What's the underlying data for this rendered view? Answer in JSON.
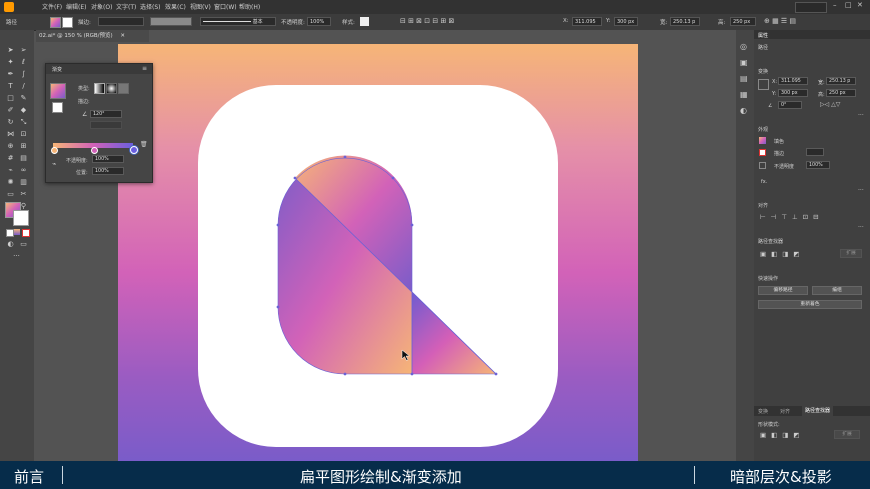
{
  "menubar": {
    "items": [
      "文件(F)",
      "编辑(E)",
      "对象(O)",
      "文字(T)",
      "选择(S)",
      "效果(C)",
      "视图(V)",
      "窗口(W)",
      "帮助(H)"
    ]
  },
  "controlbar": {
    "path_label": "路径",
    "stroke_label": "描边:",
    "stroke_style": "基本",
    "opacity_label": "不透明度:",
    "opacity_value": "100%",
    "style_label": "样式:",
    "x_label": "X:",
    "x_value": "311.095",
    "y_label": "Y:",
    "y_value": "300 px",
    "w_label": "宽:",
    "w_value": "250.13 p",
    "h_label": "高:",
    "h_value": "250 px"
  },
  "document": {
    "tab_title": "02.ai* @ 150 % (RGB/预览)"
  },
  "gradient_panel": {
    "title": "渐变",
    "type_label": "类型:",
    "stroke_label": "描边:",
    "angle_value": "120°",
    "opacity_label": "不透明度:",
    "opacity_value": "100%",
    "location_label": "位置:",
    "location_value": "100%"
  },
  "properties_panel": {
    "tab_title": "属性",
    "section_path": "路径",
    "section_transform": "变换",
    "x_label": "X:",
    "x_value": "311.095",
    "y_label": "Y:",
    "y_value": "300 px",
    "w_label": "宽:",
    "w_value": "250.13 p",
    "h_label": "高:",
    "h_value": "250 px",
    "angle_value": "0°",
    "section_appearance": "外观",
    "fill_label": "填色",
    "stroke_label": "描边",
    "opacity_label": "不透明度",
    "opacity_value": "100%",
    "fx_label": "fx.",
    "section_align": "对齐",
    "section_pathfinder": "路径查找器",
    "expand_label": "扩展",
    "section_quick_actions": "快速操作",
    "btn_offset_path": "偏移路径",
    "btn_edit": "编组",
    "btn_recolor": "重新着色",
    "bottom_tabs": [
      "变换",
      "对齐",
      "路径查找器"
    ],
    "shape_modes_label": "形状模式:",
    "bottom_expand": "扩展"
  },
  "caption": {
    "left": "前言",
    "center": "扁平图形绘制&渐变添加",
    "right": "暗部层次&投影"
  },
  "colors": {
    "gradient_start": "#f6b577",
    "gradient_mid": "#d262b8",
    "gradient_end": "#7a5cc9",
    "caption_bg": "#062c4a"
  }
}
